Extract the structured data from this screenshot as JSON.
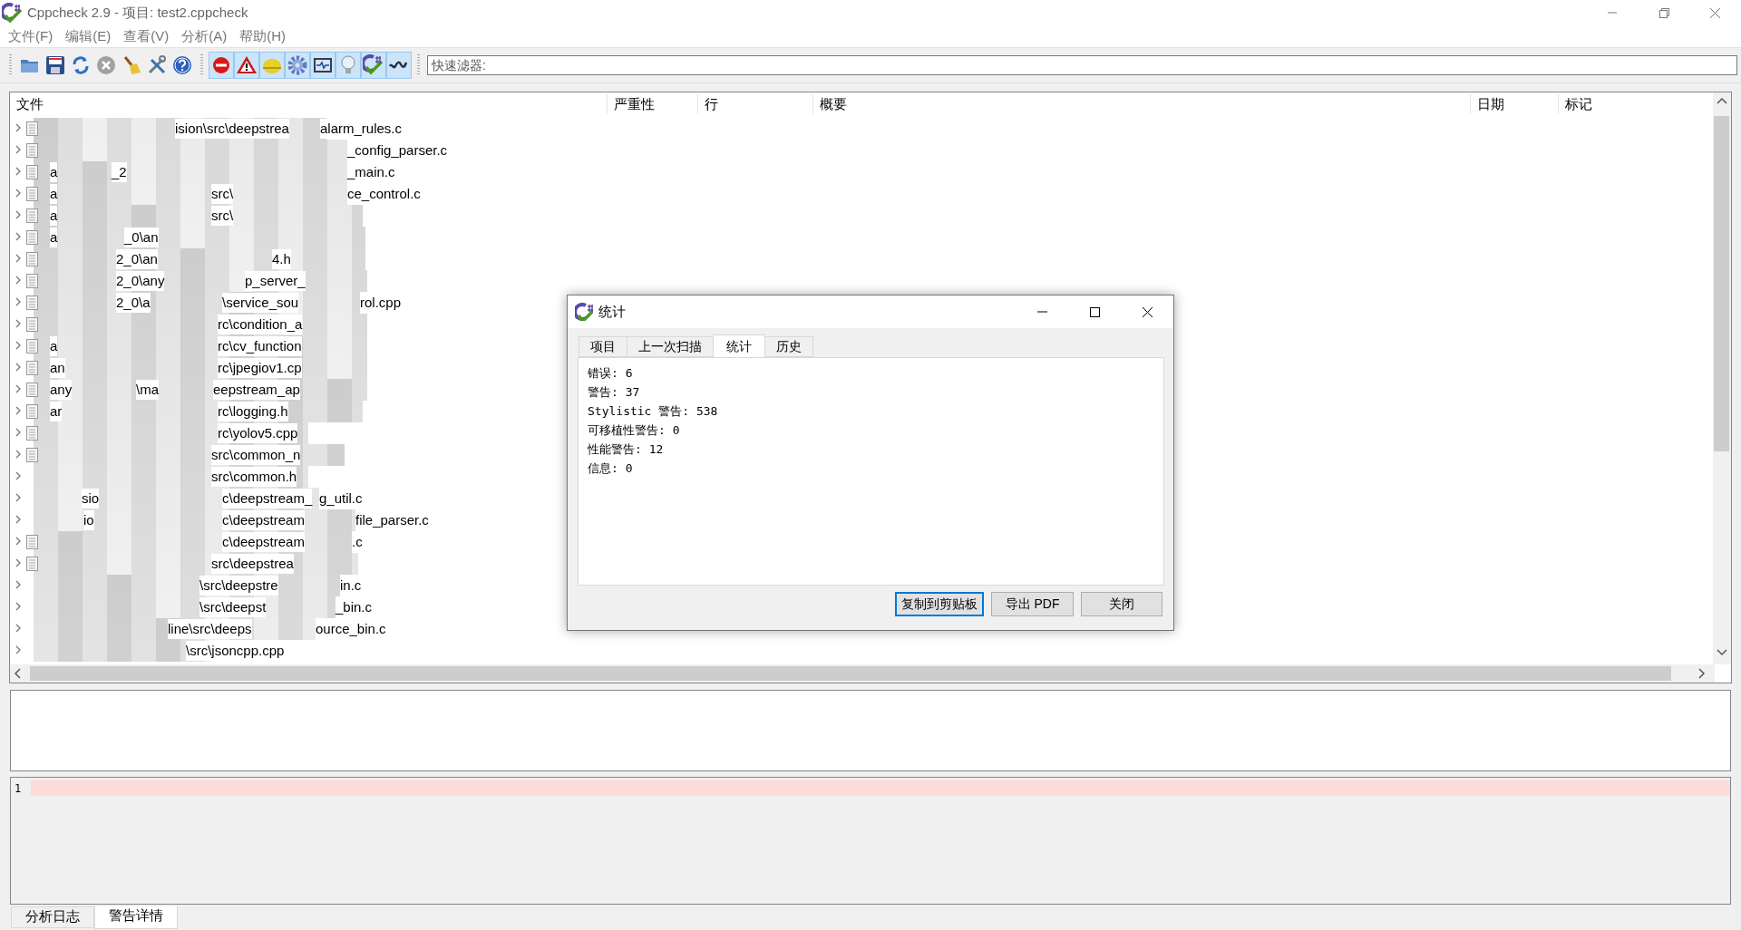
{
  "window": {
    "title": "Cppcheck 2.9 - 项目: test2.cppcheck"
  },
  "menu": [
    "文件(F)",
    "编辑(E)",
    "查看(V)",
    "分析(A)",
    "帮助(H)"
  ],
  "toolbar": [
    {
      "kind": "open",
      "on": false
    },
    {
      "kind": "save",
      "on": false
    },
    {
      "kind": "reload",
      "on": false
    },
    {
      "kind": "stop",
      "on": false
    },
    {
      "kind": "clear",
      "on": false
    },
    {
      "kind": "settings",
      "on": false
    },
    {
      "kind": "help",
      "on": false
    },
    {
      "kind": "error",
      "on": true
    },
    {
      "kind": "warning",
      "on": true
    },
    {
      "kind": "style",
      "on": true
    },
    {
      "kind": "performance",
      "on": true
    },
    {
      "kind": "portability",
      "on": true
    },
    {
      "kind": "information",
      "on": true
    },
    {
      "kind": "cppcheck",
      "on": true
    },
    {
      "kind": "unknown",
      "on": true
    }
  ],
  "filter": {
    "placeholder": "快速滤器:"
  },
  "results": {
    "columns": [
      "文件",
      "严重性",
      "行",
      "概要",
      "日期",
      "标记"
    ],
    "rows": [
      {
        "file_icon": true,
        "parts": [
          "ision\\src\\deepstrea",
          "alarm_rules.c"
        ]
      },
      {
        "file_icon": true,
        "parts": [
          "_config_parser.c"
        ]
      },
      {
        "file_icon": true,
        "parts": [
          "a",
          "_2",
          "_main.c"
        ]
      },
      {
        "file_icon": true,
        "parts": [
          "a",
          "src\\",
          "ce_control.c"
        ]
      },
      {
        "file_icon": true,
        "parts": [
          "a",
          "src\\"
        ]
      },
      {
        "file_icon": true,
        "parts": [
          "a",
          "_0\\an"
        ]
      },
      {
        "file_icon": true,
        "parts": [
          "2_0\\an",
          "4.h"
        ]
      },
      {
        "file_icon": true,
        "parts": [
          "2_0\\any",
          "p_server_"
        ]
      },
      {
        "file_icon": true,
        "parts": [
          "2_0\\a",
          "\\service_sou",
          "rol.cpp"
        ]
      },
      {
        "file_icon": true,
        "parts": [
          "rc\\condition_a"
        ]
      },
      {
        "file_icon": true,
        "parts": [
          "a",
          "rc\\cv_function"
        ]
      },
      {
        "file_icon": true,
        "parts": [
          "an",
          "rc\\jpegiov1.cp"
        ]
      },
      {
        "file_icon": true,
        "parts": [
          "any",
          "\\ma",
          "eepstream_ap"
        ]
      },
      {
        "file_icon": true,
        "parts": [
          "ar",
          "rc\\logging.h"
        ]
      },
      {
        "file_icon": true,
        "parts": [
          "rc\\yolov5.cpp"
        ]
      },
      {
        "file_icon": true,
        "parts": [
          "src\\common_n"
        ]
      },
      {
        "file_icon": false,
        "parts": [
          "src\\common.h"
        ]
      },
      {
        "file_icon": false,
        "parts": [
          "sio",
          "c\\deepstream_",
          "g_util.c"
        ]
      },
      {
        "file_icon": false,
        "parts": [
          "io",
          "c\\deepstream",
          "file_parser.c"
        ]
      },
      {
        "file_icon": true,
        "parts": [
          "c\\deepstream",
          ".c"
        ]
      },
      {
        "file_icon": true,
        "parts": [
          "src\\deepstrea"
        ]
      },
      {
        "file_icon": false,
        "parts": [
          "\\src\\deepstre",
          "in.c"
        ]
      },
      {
        "file_icon": false,
        "parts": [
          "\\src\\deepst",
          "_bin.c"
        ]
      },
      {
        "file_icon": false,
        "parts": [
          "line\\src\\deeps",
          "ource_bin.c"
        ]
      },
      {
        "file_icon": false,
        "parts": [
          "\\src\\jsoncpp.cpp"
        ]
      }
    ]
  },
  "code": {
    "lines": [
      {
        "number": "1",
        "highlighted": true
      }
    ]
  },
  "bottom_tabs": [
    {
      "label": "分析日志",
      "selected": false
    },
    {
      "label": "警告详情",
      "selected": true
    }
  ],
  "dialog": {
    "title": "统计",
    "tabs": [
      {
        "label": "项目",
        "selected": false
      },
      {
        "label": "上一次扫描",
        "selected": false
      },
      {
        "label": "统计",
        "selected": true
      },
      {
        "label": "历史",
        "selected": false
      }
    ],
    "lines": [
      "错误: 6",
      "警告: 37",
      "Stylistic 警告: 538",
      "可移植性警告: 0",
      "性能警告: 12",
      "信息: 0"
    ],
    "buttons": [
      {
        "label": "复制到剪贴板",
        "default": true
      },
      {
        "label": "导出 PDF",
        "default": false
      },
      {
        "label": "关闭",
        "default": false
      }
    ]
  }
}
